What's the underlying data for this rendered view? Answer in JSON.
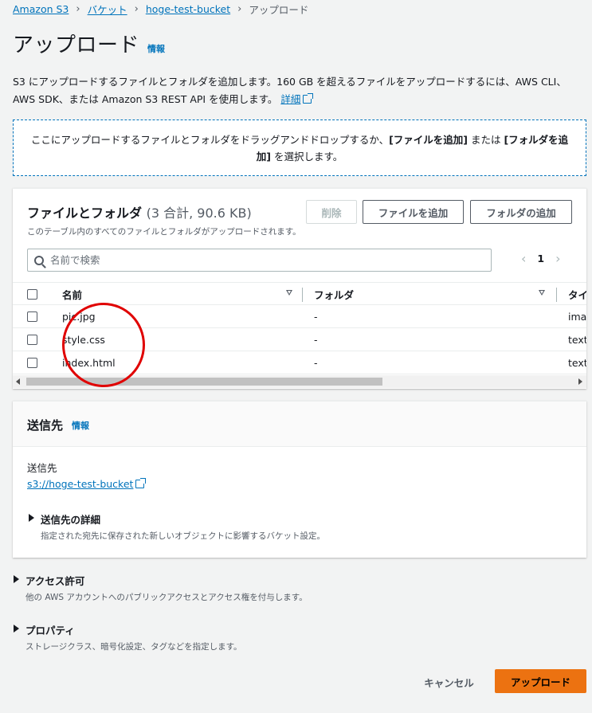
{
  "breadcrumb": {
    "items": [
      "Amazon S3",
      "バケット",
      "hoge-test-bucket"
    ],
    "current": "アップロード"
  },
  "page": {
    "title": "アップロード",
    "info_link": "情報",
    "description": "S3 にアップロードするファイルとフォルダを追加します。160 GB を超えるファイルをアップロードするには、AWS CLI、AWS SDK、または Amazon S3 REST API を使用します。",
    "details_link": "詳細"
  },
  "dropzone": {
    "text_before": "ここにアップロードするファイルとフォルダをドラッグアンドドロップするか、",
    "add_files": "[ファイルを追加]",
    "middle": " または ",
    "add_folder": "[フォルダを追加]",
    "text_after": " を選択します。"
  },
  "files": {
    "heading": "ファイルとフォルダ",
    "count": "(3 合計, 90.6 KB)",
    "subtitle": "このテーブル内のすべてのファイルとフォルダがアップロードされます。",
    "delete_label": "削除",
    "add_files_label": "ファイルを追加",
    "add_folder_label": "フォルダの追加",
    "search_placeholder": "名前で検索",
    "page_number": "1",
    "columns": {
      "name": "名前",
      "folder": "フォルダ",
      "type": "タイプ"
    },
    "rows": [
      {
        "name": "pic.jpg",
        "folder": "-",
        "type": "image/jpeg"
      },
      {
        "name": "style.css",
        "folder": "-",
        "type": "text/css"
      },
      {
        "name": "index.html",
        "folder": "-",
        "type": "text/html"
      }
    ]
  },
  "destination": {
    "title": "送信先",
    "info_link": "情報",
    "label": "送信先",
    "link": "s3://hoge-test-bucket",
    "details_title": "送信先の詳細",
    "details_desc": "指定された宛先に保存された新しいオブジェクトに影響するバケット設定。"
  },
  "access": {
    "title": "アクセス許可",
    "desc": "他の AWS アカウントへのパブリックアクセスとアクセス権を付与します。"
  },
  "properties": {
    "title": "プロパティ",
    "desc": "ストレージクラス、暗号化設定、タグなどを指定します。"
  },
  "footer": {
    "cancel": "キャンセル",
    "upload": "アップロード"
  },
  "colors": {
    "link": "#0073bb",
    "primary_button": "#ec7211",
    "annotation": "#e00000"
  }
}
